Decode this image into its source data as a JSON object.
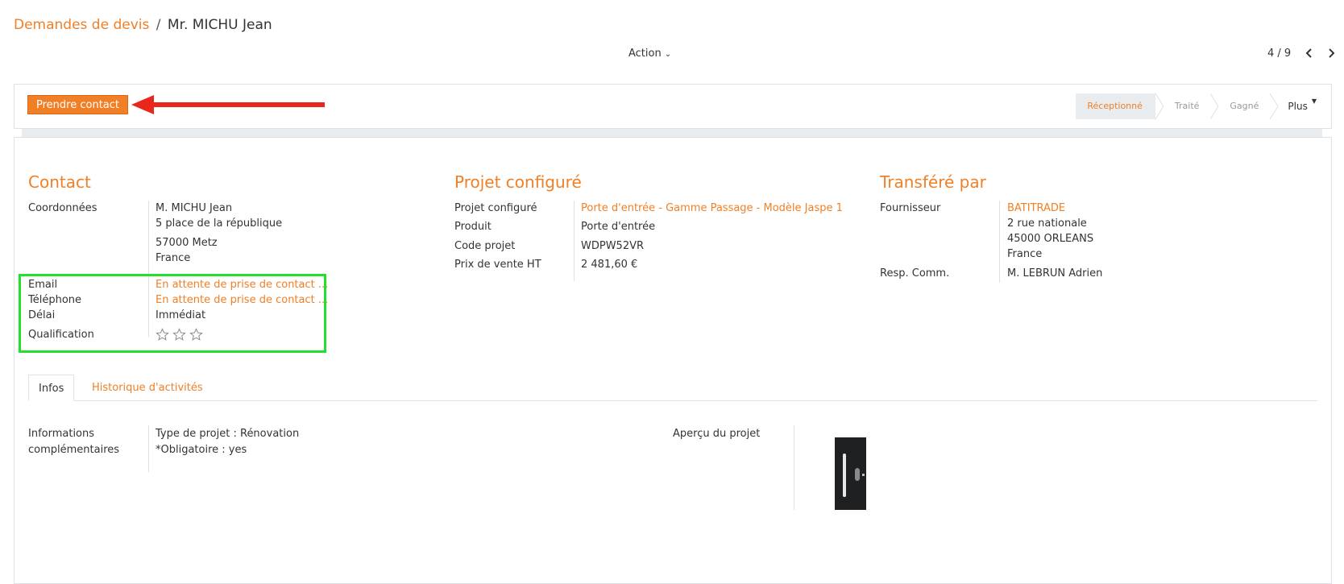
{
  "breadcrumb": {
    "parent": "Demandes de devis",
    "separator": "/",
    "current": "Mr. MICHU Jean"
  },
  "action": {
    "label": "Action"
  },
  "pager": {
    "value": "4 / 9"
  },
  "statusbar": {
    "primary_button": "Prendre contact",
    "stages": [
      "Réceptionné",
      "Traité",
      "Gagné"
    ],
    "active_stage": "Réceptionné",
    "more_label": "Plus"
  },
  "contact": {
    "title": "Contact",
    "coordonnees_label": "Coordonnées",
    "name": "M.  MICHU  Jean",
    "address_line": "5 place de la république",
    "city_line": "57000  Metz",
    "country": "France",
    "email_label": "Email",
    "email_value": "En attente de prise de contact ...",
    "phone_label": "Téléphone",
    "phone_value": "En attente de prise de contact ...",
    "delay_label": "Délai",
    "delay_value": "Immédiat",
    "qualification_label": "Qualification",
    "qualification_stars": 0,
    "qualification_max": 3
  },
  "projet": {
    "title": "Projet configuré",
    "configured_label": "Projet configuré",
    "configured_value": "Porte d'entrée - Gamme Passage - Modèle Jaspe 1",
    "product_label": "Produit",
    "product_value": "Porte d'entrée",
    "code_label": "Code projet",
    "code_value": "WDPW52VR",
    "price_label": "Prix de vente HT",
    "price_value": "2 481,60 €"
  },
  "transfere": {
    "title": "Transféré par",
    "supplier_label": "Fournisseur",
    "supplier_name": "BATITRADE",
    "supplier_street": "2 rue nationale",
    "supplier_city": "45000 ORLEANS",
    "supplier_country": "France",
    "resp_label": "Resp. Comm.",
    "resp_value": "M. LEBRUN Adrien"
  },
  "tabs": {
    "active": "Infos",
    "other": "Historique d'activités"
  },
  "infos": {
    "label_line1": "Informations",
    "label_line2": "complémentaires",
    "value_line1": "Type de projet : Rénovation",
    "value_line2": "*Obligatoire : yes",
    "preview_label": "Aperçu du projet"
  },
  "colors": {
    "accent": "#f07f25",
    "highlight": "#22e02c",
    "arrow": "#e8261c"
  }
}
